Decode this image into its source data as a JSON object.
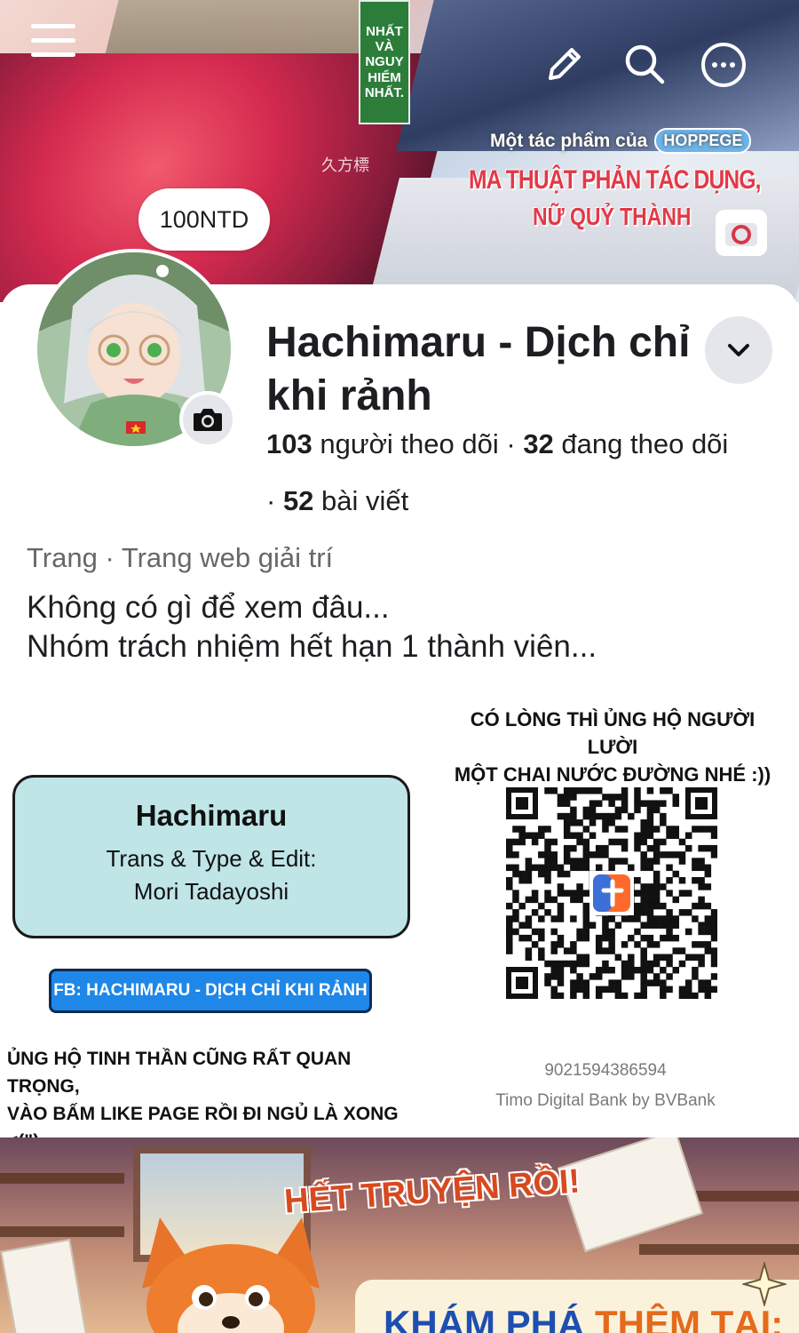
{
  "cover": {
    "banner_text": [
      "NHẤT",
      "VÀ",
      "NGUY",
      "HIỂM",
      "NHẤT."
    ],
    "credit_prefix": "Một tác phẩm của",
    "credit_brand": "HOPPEGE",
    "title_line1": "MA THUẬT PHẢN TÁC DỤNG,",
    "title_line2": "NỮ QUỶ THÀNH",
    "kanji": "久方標"
  },
  "header": {
    "icons": [
      "menu-icon",
      "edit-icon",
      "search-icon",
      "more-icon"
    ]
  },
  "profile": {
    "note": "100NTD",
    "name": "Hachimaru - Dịch chỉ khi rảnh",
    "followers_count": "103",
    "followers_label": "người theo dõi",
    "following_count": "32",
    "following_label": "đang theo dõi",
    "posts_count": "52",
    "posts_label": "bài viết",
    "category": "Trang · Trang web giải trí",
    "bio_line1": "Không có gì để xem đâu...",
    "bio_line2": "Nhóm trách nhiệm hết hạn 1 thành viên..."
  },
  "credits": {
    "group": "Hachimaru",
    "role": "Trans & Type & Edit:",
    "member": "Mori Tadayoshi",
    "fb_label": "FB: HACHIMARU - DỊCH CHỈ KHI RẢNH",
    "support_line1": "ỦNG HỘ TINH THẦN CŨNG RẤT QUAN TRỌNG,",
    "support_line2": "VÀO BẤM LIKE PAGE RỒI ĐI NGỦ LÀ XONG <(\")"
  },
  "donate": {
    "heading_line1": "CÓ LÒNG THÌ ỦNG HỘ NGƯỜI LƯỜI",
    "heading_line2": "MỘT CHAI NƯỚC ĐƯỜNG NHÉ :))",
    "account_number": "9021594386594",
    "bank": "Timo Digital Bank by BVBank"
  },
  "end_banner": {
    "title": "HẾT TRUYỆN RỒI!",
    "explore_a": "KHÁM PHÁ",
    "explore_b": "THÊM TẠI:"
  },
  "colors": {
    "card_bg": "#bfe5e7",
    "fb_pill": "#1e87e8",
    "secondary_text": "#65676b",
    "dropdown_bg": "#e4e6eb"
  }
}
